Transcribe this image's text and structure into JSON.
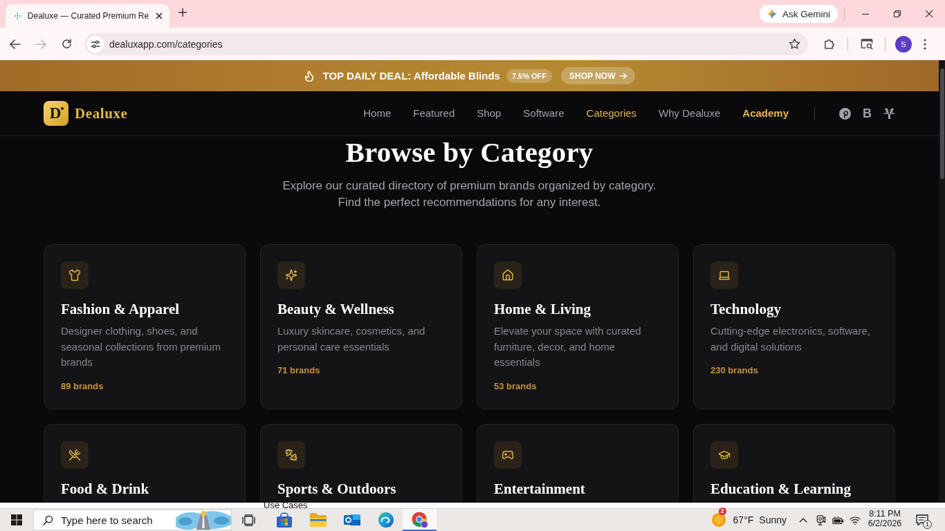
{
  "browser": {
    "tab": {
      "title": "Dealuxe — Curated Premium Re",
      "selected": true
    },
    "ask_button": "Ask Gemini",
    "forward": {
      "disabled": true
    },
    "url": "dealuxapp.com/categories",
    "profile_initial": "S"
  },
  "promo": {
    "text": "TOP DAILY DEAL: Affordable Blinds",
    "badge": "7.5% OFF",
    "button": "SHOP NOW"
  },
  "nav": {
    "logo_mark": "D",
    "brand": "Dealuxe",
    "links": [
      {
        "label": "Home",
        "kind": "link",
        "selected": false
      },
      {
        "label": "Featured",
        "kind": "link",
        "selected": false
      },
      {
        "label": "Shop",
        "kind": "link",
        "selected": false
      },
      {
        "label": "Software",
        "kind": "link",
        "selected": false
      },
      {
        "label": "Categories",
        "kind": "link",
        "selected": true
      },
      {
        "label": "Why Dealuxe",
        "kind": "link",
        "selected": false
      },
      {
        "label": "Academy",
        "kind": "accent",
        "selected": false
      }
    ],
    "social_letter": "B"
  },
  "hero": {
    "title": "Browse by Category",
    "subtitle": [
      "Explore our curated directory of premium brands organized by category.",
      "Find the perfect recommendations for any interest."
    ]
  },
  "categories": [
    {
      "title": "Fashion & Apparel",
      "description": "Designer clothing, shoes, and seasonal collections from premium brands",
      "count": "89 brands"
    },
    {
      "title": "Beauty & Wellness",
      "description": "Luxury skincare, cosmetics, and personal care essentials",
      "count": "71 brands"
    },
    {
      "title": "Home & Living",
      "description": "Elevate your space with curated furniture, decor, and home essentials",
      "count": "53 brands"
    },
    {
      "title": "Technology",
      "description": "Cutting-edge electronics, software, and digital solutions",
      "count": "230 brands"
    },
    {
      "title": "Food & Drink"
    },
    {
      "title": "Sports & Outdoors"
    },
    {
      "title": "Entertainment"
    },
    {
      "title": "Education & Learning"
    }
  ],
  "taskbar": {
    "tooltip": "Use Cases",
    "search": {
      "placeholder": "Type here to search"
    },
    "apps": [
      {
        "selected": false
      },
      {
        "selected": false
      },
      {
        "selected": false
      },
      {
        "selected": false
      },
      {
        "selected": true
      }
    ],
    "weather": {
      "badge": "2",
      "temperature": "67°F",
      "condition": "Sunny"
    },
    "clock": {
      "time": "8:11 PM",
      "date": "6/2/2026"
    },
    "notifications": "1"
  }
}
